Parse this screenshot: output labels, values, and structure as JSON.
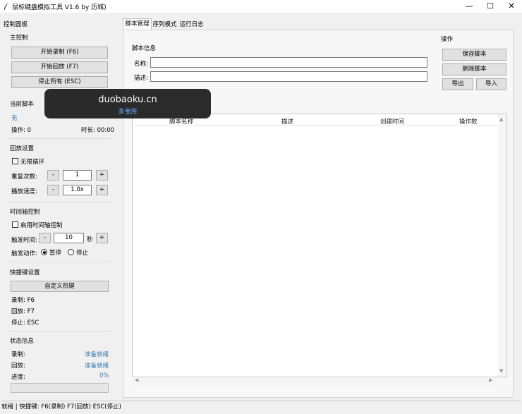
{
  "window": {
    "title": "鼠标键盘模拟工具 V1.6 by 历城)",
    "minimize": "—",
    "maximize": "☐",
    "close": "✕"
  },
  "left": {
    "panel_title": "控制面板",
    "main_control": {
      "title": "主控制",
      "record_button": "开始录制 (F6)",
      "play_button": "开始回放 (F7)",
      "stop_button": "停止所有 (ESC)"
    },
    "current_script": {
      "title": "当前脚本",
      "name": "无",
      "ops": "操作: 0",
      "duration": "时长: 00:00"
    },
    "playback": {
      "title": "回放设置",
      "infinite_loop": "无限循环",
      "repeat_label": "重复次数:",
      "repeat_value": "1",
      "speed_label": "播放速度:",
      "speed_value": "1.0x",
      "minus": "-",
      "plus": "+"
    },
    "timeline": {
      "title": "时间轴控制",
      "enable": "启用时间轴控制",
      "trigger_label": "触发时间:",
      "trigger_value": "10",
      "unit": "秒",
      "action_label": "触发动作:",
      "pause": "暂停",
      "stop": "停止",
      "minus": "-",
      "plus": "+"
    },
    "hotkeys": {
      "title": "快捷键设置",
      "custom_button": "自定义热键",
      "record": "录制: F6",
      "play": "回放: F7",
      "stop": "停止: ESC"
    },
    "status": {
      "title": "状态信息",
      "record_label": "录制:",
      "record_value": "准备就绪",
      "play_label": "回放:",
      "play_value": "准备就绪",
      "progress_label": "进度:",
      "progress_value": "0%",
      "progress_fraction": 0
    }
  },
  "tabs": [
    "脚本管理",
    "序列模式",
    "运行日志"
  ],
  "script_info": {
    "title": "脚本信息",
    "name_label": "名称:",
    "desc_label": "描述:",
    "name_value": "",
    "desc_value": ""
  },
  "actions": {
    "title": "操作",
    "save": "保存脚本",
    "delete": "删除脚本",
    "export": "导出",
    "import": "导入"
  },
  "table": {
    "columns": [
      "脚本名称",
      "描述",
      "创建时间",
      "操作数"
    ],
    "rows": []
  },
  "statusbar": {
    "text": "就绪 | 快捷键: F6(录制) F7(回放) ESC(停止)"
  },
  "watermark": {
    "site": "duobaoku.cn",
    "name": "多宝库"
  },
  "colors": {
    "accent_text": "#3a7ab0",
    "background": "#f0f0f0",
    "button": "#e1e1e1"
  }
}
